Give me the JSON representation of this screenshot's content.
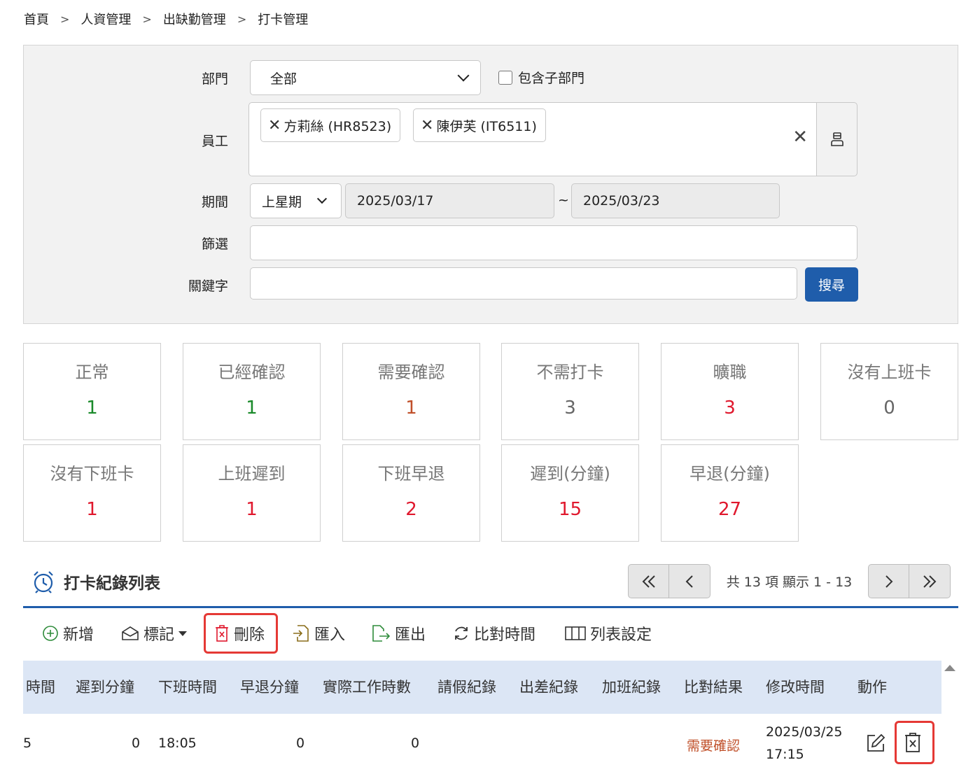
{
  "breadcrumb": [
    "首頁",
    "人資管理",
    "出缺勤管理",
    "打卡管理"
  ],
  "filter": {
    "dept_label": "部門",
    "dept_value": "全部",
    "include_sub_label": "包含子部門",
    "emp_label": "員工",
    "employees": [
      "方莉絲 (HR8523)",
      "陳伊芙 (IT6511)"
    ],
    "period_label": "期間",
    "period_value": "上星期",
    "date_from": "2025/03/17",
    "date_sep": "~",
    "date_to": "2025/03/23",
    "filter_label": "篩選",
    "filter_value": "",
    "keyword_label": "關鍵字",
    "keyword_value": "",
    "search_label": "搜尋"
  },
  "stats": [
    {
      "label": "正常",
      "value": "1",
      "color": "#1a8a2a"
    },
    {
      "label": "已經確認",
      "value": "1",
      "color": "#1a8a2a"
    },
    {
      "label": "需要確認",
      "value": "1",
      "color": "#c0502a"
    },
    {
      "label": "不需打卡",
      "value": "3",
      "color": "#666666"
    },
    {
      "label": "曠職",
      "value": "3",
      "color": "#e0182d"
    },
    {
      "label": "沒有上班卡",
      "value": "0",
      "color": "#666666"
    },
    {
      "label": "沒有下班卡",
      "value": "1",
      "color": "#e0182d"
    },
    {
      "label": "上班遲到",
      "value": "1",
      "color": "#e0182d"
    },
    {
      "label": "下班早退",
      "value": "2",
      "color": "#e0182d"
    },
    {
      "label": "遲到(分鐘)",
      "value": "15",
      "color": "#e0182d"
    },
    {
      "label": "早退(分鐘)",
      "value": "27",
      "color": "#e0182d"
    }
  ],
  "list": {
    "title": "打卡紀錄列表",
    "pager_info": "共 13 項 顯示 1 - 13",
    "toolbar": {
      "add": "新增",
      "mark": "標記",
      "delete": "刪除",
      "import": "匯入",
      "export": "匯出",
      "compare": "比對時間",
      "settings": "列表設定"
    },
    "columns": [
      "時間",
      "遲到分鐘",
      "下班時間",
      "早退分鐘",
      "實際工作時數",
      "請假紀錄",
      "出差紀錄",
      "加班紀錄",
      "比對結果",
      "修改時間",
      "動作"
    ],
    "row": {
      "in_time_partial": "5",
      "late_min": "0",
      "out_time": "18:05",
      "early_min": "0",
      "work_hours": "0",
      "compare_result": "需要確認",
      "modified_date": "2025/03/25",
      "modified_time": "17:15"
    }
  }
}
